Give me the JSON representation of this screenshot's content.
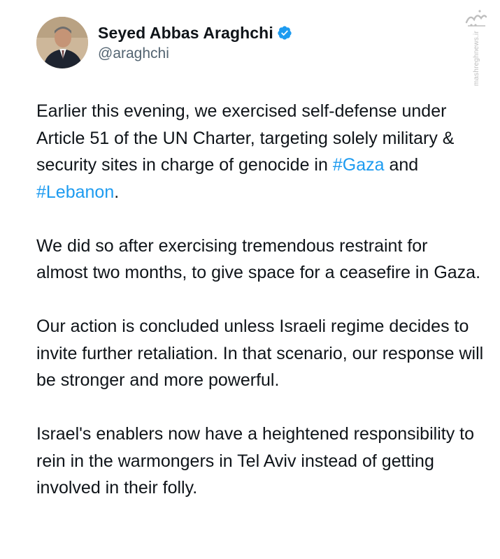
{
  "tweet": {
    "author": {
      "display_name": "Seyed Abbas Araghchi",
      "handle": "@araghchi",
      "verified": true
    },
    "paragraphs": [
      {
        "segments": [
          {
            "text": "Earlier this evening, we exercised self-defense under Article 51 of the UN Charter, targeting solely military & security sites in charge of genocide in ",
            "hashtag": false
          },
          {
            "text": "#Gaza",
            "hashtag": true
          },
          {
            "text": " and ",
            "hashtag": false
          },
          {
            "text": "#Lebanon",
            "hashtag": true
          },
          {
            "text": ".",
            "hashtag": false
          }
        ]
      },
      {
        "segments": [
          {
            "text": "We did so after exercising tremendous restraint for almost two months, to give space for a ceasefire in Gaza.",
            "hashtag": false
          }
        ]
      },
      {
        "segments": [
          {
            "text": "Our action is concluded unless Israeli regime decides to invite further retaliation. In that scenario, our response will be stronger and more powerful.",
            "hashtag": false
          }
        ]
      },
      {
        "segments": [
          {
            "text": "Israel's enablers now have a heightened responsibility to rein in the warmongers in Tel Aviv instead of getting involved in their folly.",
            "hashtag": false
          }
        ]
      }
    ]
  },
  "watermark": {
    "text": "mashreghnews.ir"
  },
  "colors": {
    "hashtag": "#1d9bf0",
    "verified_badge": "#1d9bf0",
    "text": "#0f1419",
    "handle": "#536471"
  },
  "icons": {
    "verified": "verified-badge-icon",
    "watermark": "mashregh-logo-icon"
  }
}
